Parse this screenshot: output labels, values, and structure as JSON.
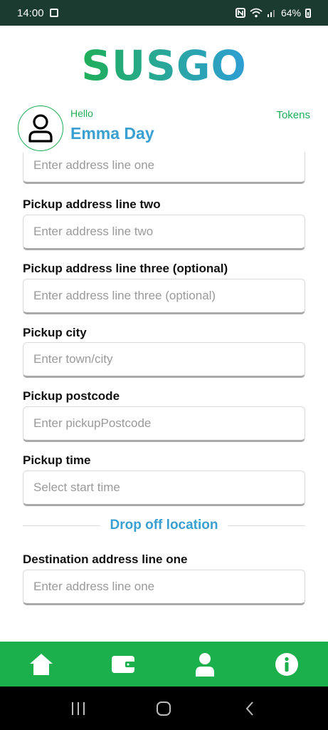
{
  "status_bar": {
    "time": "14:00",
    "battery": "64%"
  },
  "app": {
    "logo": "SUSGO"
  },
  "user": {
    "greeting": "Hello",
    "name": "Emma Day",
    "tokens_label": "Tokens"
  },
  "form": {
    "pickup_line_one": {
      "placeholder": "Enter address line one"
    },
    "pickup_line_two": {
      "label": "Pickup address line two",
      "placeholder": "Enter address line two"
    },
    "pickup_line_three": {
      "label": "Pickup address line three (optional)",
      "placeholder": "Enter address line three (optional)"
    },
    "pickup_city": {
      "label": "Pickup city",
      "placeholder": "Enter town/city"
    },
    "pickup_postcode": {
      "label": "Pickup postcode",
      "placeholder": "Enter pickupPostcode"
    },
    "pickup_time": {
      "label": "Pickup time",
      "placeholder": "Select start time"
    },
    "drop_off_heading": "Drop off location",
    "destination_line_one": {
      "label": "Destination address line one",
      "placeholder": "Enter address line one"
    }
  },
  "nav": {
    "items": [
      {
        "icon": "home-icon"
      },
      {
        "icon": "wallet-icon"
      },
      {
        "icon": "profile-icon"
      },
      {
        "icon": "info-icon"
      }
    ]
  },
  "colors": {
    "brand_green": "#1bb04b",
    "brand_blue": "#3a9fd1",
    "status_bar": "#1b3b30"
  }
}
